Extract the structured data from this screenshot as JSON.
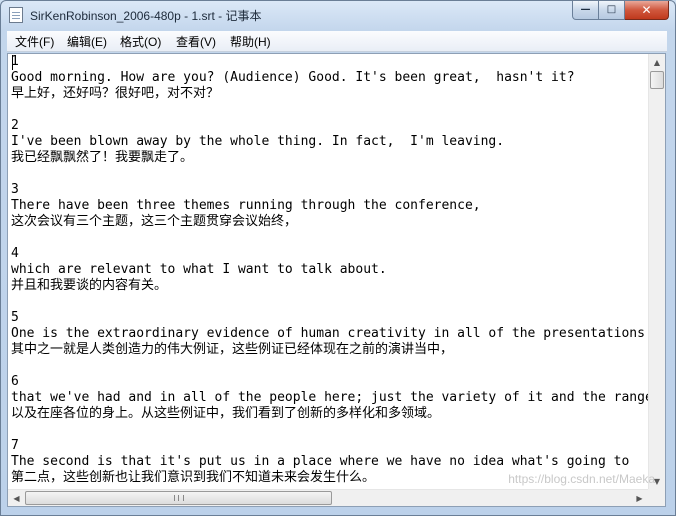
{
  "window": {
    "title": "SirKenRobinson_2006-480p - 1.srt - 记事本",
    "icon": "notepad-icon",
    "minimize_glyph": "—",
    "maximize_glyph": "□",
    "close_glyph": "✕"
  },
  "menu": [
    {
      "label": "文件(F)"
    },
    {
      "label": "编辑(E)"
    },
    {
      "label": "格式(O)"
    },
    {
      "label": "查看(V)"
    },
    {
      "label": "帮助(H)"
    }
  ],
  "document": {
    "lines": [
      "1",
      "Good morning. How are you? (Audience) Good. It's been great,  hasn't it?",
      "早上好，还好吗？很好吧，对不对？",
      "",
      "2",
      "I've been blown away by the whole thing. In fact,  I'm leaving.",
      "我已经飘飘然了！我要飘走了。",
      "",
      "3",
      "There have been three themes running through the conference,",
      "这次会议有三个主题，这三个主题贯穿会议始终，",
      "",
      "4",
      "which are relevant to what I want to talk about.",
      "并且和我要谈的内容有关。",
      "",
      "5",
      "One is the extraordinary evidence of human creativity in all of the presentations",
      "其中之一就是人类创造力的伟大例证，这些例证已经体现在之前的演讲当中，",
      "",
      "6",
      "that we've had and in all of the people here; just the variety of it and the range",
      "以及在座各位的身上。从这些例证中，我们看到了创新的多样化和多领域。",
      "",
      "7",
      "The second is that it's put us in a place where we have no idea what's going to",
      "第二点，这些创新也让我们意识到我们不知道未来会发生什么。"
    ]
  },
  "watermark": "https://blog.csdn.net/Maeka"
}
